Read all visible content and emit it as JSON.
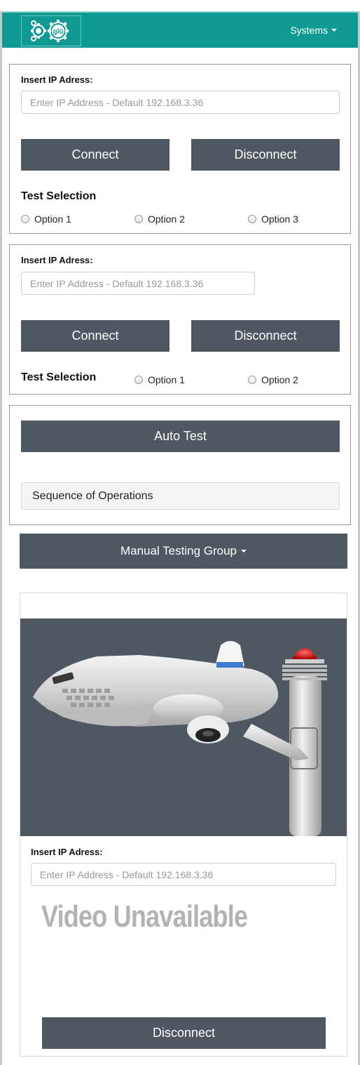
{
  "navbar": {
    "logo_text": "glü",
    "systems_label": "Systems"
  },
  "panel1": {
    "ip_label": "Insert IP Adress:",
    "ip_placeholder": "Enter IP Address - Default 192.168.3.36",
    "connect_label": "Connect",
    "disconnect_label": "Disconnect",
    "test_selection_label": "Test Selection",
    "options": [
      "Option 1",
      "Option 2",
      "Option 3"
    ]
  },
  "panel2": {
    "ip_label": "Insert IP Adress:",
    "ip_placeholder": "Enter IP Address - Default 192.168.3.36",
    "connect_label": "Connect",
    "disconnect_label": "Disconnect",
    "test_selection_label": "Test Selection",
    "options": [
      "Option 1",
      "Option 2"
    ]
  },
  "panel3": {
    "auto_test_label": "Auto Test",
    "sequence_label": "Sequence of Operations"
  },
  "manual_group": {
    "label": "Manual Testing Group"
  },
  "camera_card": {
    "ip_label": "Insert IP Adress:",
    "ip_placeholder": "Enter IP Address - Default 192.168.3.36",
    "video_status": "Video Unavailable",
    "disconnect_label": "Disconnect"
  },
  "colors": {
    "navbar": "#0e9a93",
    "button": "#4f5760"
  }
}
